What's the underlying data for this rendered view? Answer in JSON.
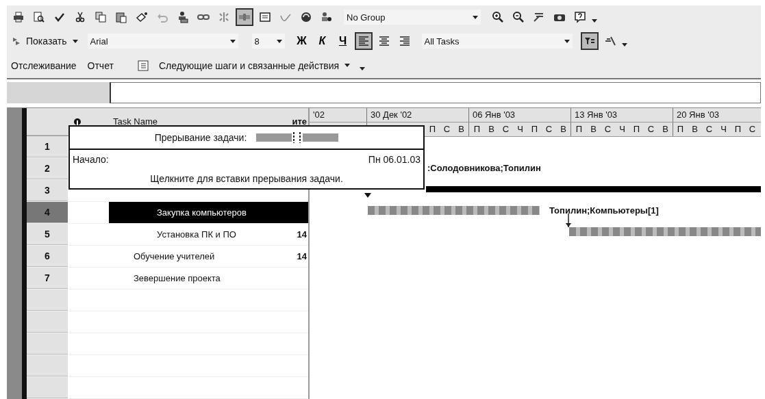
{
  "standard_toolbar": {
    "buttons": [
      {
        "pressed": false
      },
      {
        "pressed": false
      },
      {
        "pressed": false
      },
      {
        "pressed": false
      },
      {
        "pressed": false
      },
      {
        "pressed": false
      },
      {
        "pressed": false
      },
      {
        "pressed": false
      },
      {
        "pressed": false
      },
      {
        "pressed": false
      },
      {
        "pressed": false
      },
      {
        "pressed": true
      },
      {
        "pressed": false
      },
      {
        "pressed": false
      },
      {
        "pressed": false
      },
      {
        "pressed": false
      }
    ],
    "group_select": {
      "value": "No Group"
    },
    "view_buttons": [
      {
        "pressed": false
      },
      {
        "pressed": false
      },
      {
        "pressed": false
      },
      {
        "pressed": false
      },
      {
        "pressed": false
      }
    ]
  },
  "formatting_toolbar": {
    "show_button": {
      "label": "Показать"
    },
    "font_select": {
      "value": "Arial"
    },
    "size_select": {
      "value": "8"
    },
    "style_buttons": [
      {
        "kind": "bold",
        "label": "Ж",
        "pressed": false
      },
      {
        "kind": "italic",
        "label": "К",
        "pressed": false
      },
      {
        "kind": "underline",
        "label": "Ч",
        "pressed": false
      }
    ],
    "align_buttons": [
      {
        "pressed": true
      },
      {
        "pressed": false
      },
      {
        "pressed": false
      }
    ],
    "filter_select": {
      "value": "All Tasks"
    },
    "tool_buttons": [
      {
        "pressed": true
      },
      {
        "pressed": false
      }
    ]
  },
  "guide_toolbar": {
    "tracking_button": "Отслеживание",
    "report_button": "Отчет",
    "next_steps_menu": "Следующие шаги и связанные действия"
  },
  "table": {
    "columns": [
      {
        "label": "Task Name"
      },
      {
        "label": "ите"
      }
    ],
    "rows": [
      {
        "number": "1",
        "selected": false
      },
      {
        "number": "2",
        "selected": false
      },
      {
        "number": "3",
        "selected": false,
        "children": [
          {
            "number": "4",
            "name": "Закупка компьютеров",
            "selected": true
          },
          {
            "number": "5",
            "name": "Установка ПК и ПО",
            "duration": "14",
            "selected": false
          }
        ]
      },
      {
        "number": "6",
        "name": "Обучение учителей",
        "duration": "14",
        "selected": false
      },
      {
        "number": "7",
        "name": "Зевершение проекта",
        "selected": false
      }
    ]
  },
  "gantt": {
    "timescale": [
      {
        "label": "'02"
      },
      {
        "label": "30 Дек '02",
        "days": [
          "П",
          "С",
          "В"
        ]
      },
      {
        "label": "06 Янв '03",
        "days": [
          "П",
          "В",
          "С",
          "Ч",
          "П",
          "С",
          "В"
        ]
      },
      {
        "label": "13 Янв '03",
        "days": [
          "П",
          "В",
          "С",
          "Ч",
          "П",
          "С",
          "В"
        ]
      },
      {
        "label": "20 Янв '03",
        "days": [
          "П",
          "В",
          "С",
          "Ч",
          "П",
          "С"
        ]
      }
    ],
    "rows": [
      {
        "kind": "empty"
      },
      {
        "kind": "label",
        "label": ":Солодовникова;Топилин"
      },
      {
        "kind": "summary"
      },
      {
        "kind": "task",
        "label": "Топилин;Компьютеры[1]",
        "linked": false
      },
      {
        "kind": "task",
        "linked": true
      }
    ]
  },
  "popup": {
    "title": "Прерывание задачи:",
    "start_label": "Начало:",
    "start_value": "Пн 06.01.03",
    "hint": "Щелкните для вставки прерывания задачи."
  }
}
